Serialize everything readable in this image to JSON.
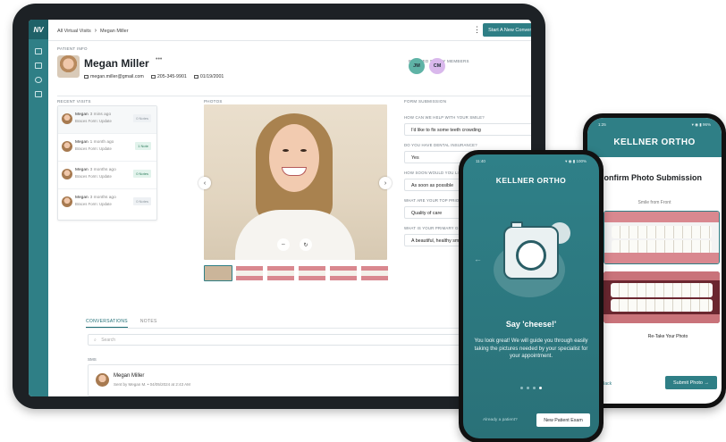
{
  "tablet": {
    "breadcrumb": {
      "root": "All Virtual Visits",
      "current": "Megan Miller"
    },
    "new_conversation_label": "Start A New Conversation",
    "patient_info_label": "PATIENT INFO",
    "patient": {
      "name": "Megan Miller",
      "more": "•••",
      "email": "megan.miller@gmail.com",
      "phone": "205-345-9901",
      "dob": "01/19/2001"
    },
    "family_label": "REALTED FAMILY MEMBERS",
    "family": [
      {
        "initials": "JM",
        "color": "#5fb3a6"
      },
      {
        "initials": "CM",
        "color": "#d9b8ec"
      }
    ],
    "recent_visits_label": "RECENT VISITS",
    "visits": [
      {
        "name": "Megan",
        "time": "3 mins ago",
        "sub": "Braces Form: Update",
        "badge": "0 Notes",
        "badge_bg": "#eef1f4",
        "badge_fg": "#8a949c"
      },
      {
        "name": "Megan",
        "time": "1 month ago",
        "sub": "Braces Form: Update",
        "badge": "1 Note",
        "badge_bg": "#e2f3ec",
        "badge_fg": "#2e7d5c"
      },
      {
        "name": "Megan",
        "time": "3 months ago",
        "sub": "Braces Form: Update",
        "badge": "0 Notes",
        "badge_bg": "#e2f3ec",
        "badge_fg": "#2e7d5c"
      },
      {
        "name": "Megan",
        "time": "3 months ago",
        "sub": "Braces Form: Update",
        "badge": "0 Notes",
        "badge_bg": "#eef1f4",
        "badge_fg": "#8a949c"
      }
    ],
    "photos_label": "PHOTOS",
    "form_label": "FORM SUBMISSION",
    "form": [
      {
        "q": "HOW CAN WE HELP WITH YOUR SMILE?",
        "a": "I'd like to fix some teeth crowding"
      },
      {
        "q": "DO YOU HAVE DENTAL INSURANCE?",
        "a": "Yes"
      },
      {
        "q": "HOW SOON WOULD YOU LIKE TO START?",
        "a": "As soon as possible"
      },
      {
        "q": "WHAT ARE YOUR TOP PRIORITIES?",
        "a": "Quality of care"
      },
      {
        "q": "WHAT IS YOUR PRIMARY GOAL?",
        "a": "A beautiful, healthy smile"
      }
    ],
    "tabs": {
      "conversations": "CONVERSATIONS",
      "notes": "NOTES"
    },
    "search_placeholder": "Search",
    "sms_label": "SMS",
    "message": {
      "name": "Megan Miller",
      "meta": "Sent by Megan M. • 04/05/2024 at 2:43 AM"
    }
  },
  "phone_front": {
    "time": "11:40",
    "status_icons": "▾ ◉ ▮ 100%",
    "brand": "KELLNER ORTHO",
    "headline": "Say 'cheese!'",
    "body": "You look great! We will guide you through easily taking the pictures needed by your specialist for your appointment.",
    "pager_total": 4,
    "pager_active": 4,
    "already_label": "Already a patient?",
    "new_exam_label": "New Patient Exam"
  },
  "phone_back": {
    "time": "1:25",
    "status_icons": "▾ ◉ ▮ 96%",
    "brand": "KELLNER ORTHO",
    "title": "Confirm Photo Submission",
    "subtitle": "Smile from Front",
    "retake_label": "Re-Take Your Photo",
    "back_label": "Back",
    "submit_label": "Submit Photo →"
  },
  "colors": {
    "brand_teal": "#2f7f86",
    "teal_dark": "#1f6168"
  }
}
